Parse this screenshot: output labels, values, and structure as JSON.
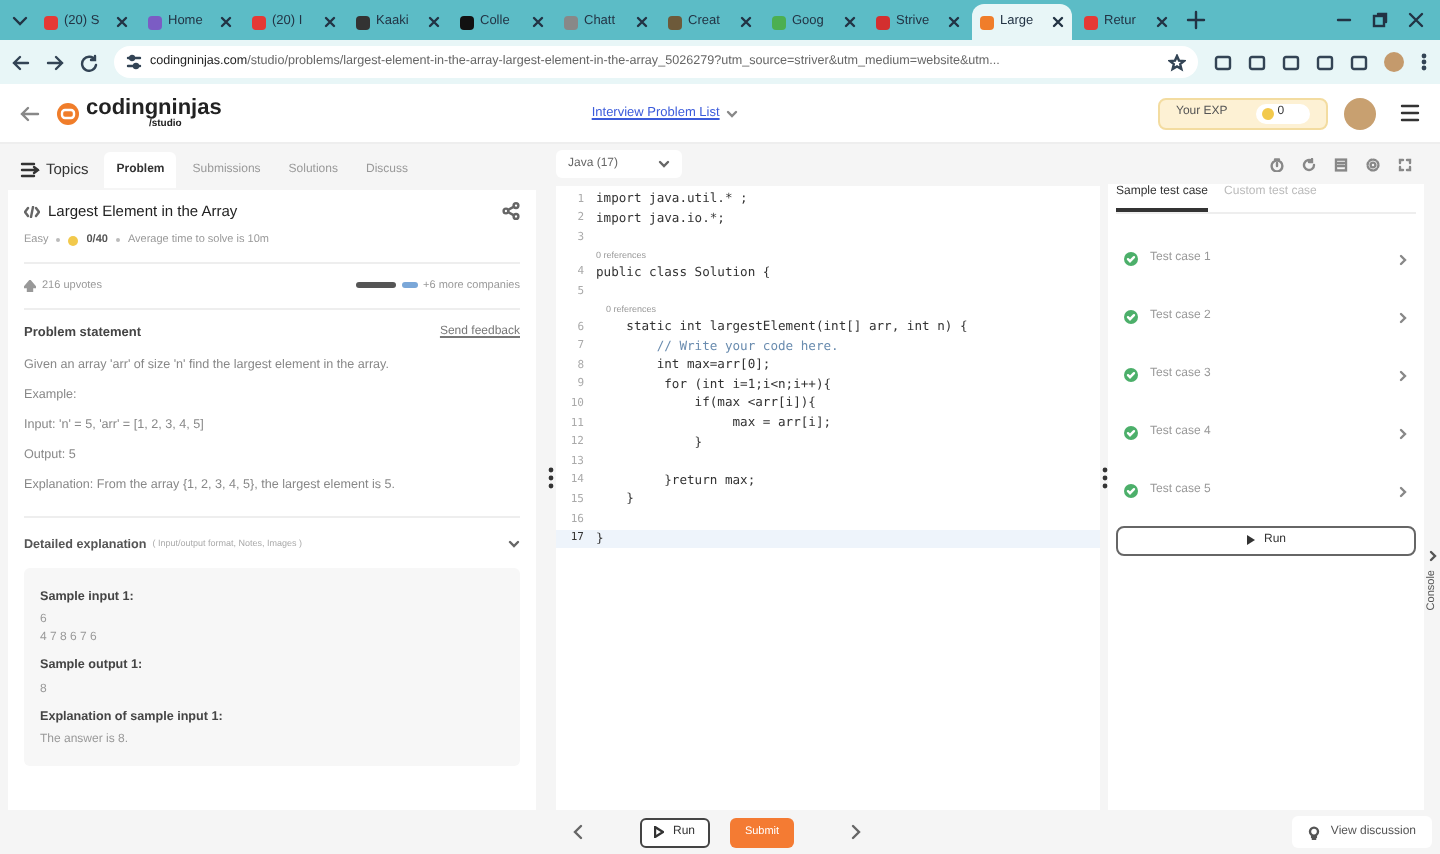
{
  "browser": {
    "tabs": [
      {
        "title": "(20) S",
        "selected": false,
        "color": "#e53935"
      },
      {
        "title": "Home",
        "selected": false,
        "color": "#7b5cc4"
      },
      {
        "title": "(20) I",
        "selected": false,
        "color": "#e53935"
      },
      {
        "title": "Kaaki",
        "selected": false,
        "color": "#333333"
      },
      {
        "title": "Colle",
        "selected": false,
        "color": "#111111"
      },
      {
        "title": "Chatt",
        "selected": false,
        "color": "#888888"
      },
      {
        "title": "Creat",
        "selected": false,
        "color": "#6d5a3a"
      },
      {
        "title": "Goog",
        "selected": false,
        "color": "#4caf50"
      },
      {
        "title": "Strive",
        "selected": false,
        "color": "#d32f2f"
      },
      {
        "title": "Large",
        "selected": true,
        "color": "#f07d2a"
      },
      {
        "title": "Retur",
        "selected": false,
        "color": "#e53935"
      }
    ],
    "url_host": "codingninjas.com",
    "url_path": "/studio/problems/largest-element-in-the-array-largest-element-in-the-array_5026279?utm_source=striver&utm_medium=website&utm..."
  },
  "header": {
    "logo": "codingninjas",
    "logo_sub": "/studio",
    "nav_link": "Interview Problem List",
    "exp_label": "Your EXP",
    "exp_value": "0"
  },
  "left": {
    "tabs": [
      {
        "label": "Topics",
        "selected": false
      },
      {
        "label": "Problem",
        "selected": true
      },
      {
        "label": "Submissions",
        "selected": false
      },
      {
        "label": "Solutions",
        "selected": false
      },
      {
        "label": "Discuss",
        "selected": false
      }
    ],
    "title": "Largest Element in the Array",
    "difficulty": "Easy",
    "score": "0/40",
    "avg_time": "Average time to solve is 10m",
    "upvotes": "216 upvotes",
    "companies": "+6 more companies",
    "statement_title": "Problem statement",
    "feedback": "Send feedback",
    "paragraphs": [
      "Given an array 'arr' of size 'n' find the largest element in the array.",
      "Example:",
      "Input: 'n' = 5, 'arr' = [1, 2, 3, 4, 5]",
      "Output: 5",
      "Explanation: From the array {1, 2, 3, 4, 5}, the largest element is 5."
    ],
    "detail_title": "Detailed explanation",
    "detail_hint": "( Input/output format, Notes, Images )",
    "expanded": true,
    "sample": [
      {
        "kind": "heading",
        "text": "Sample input 1:"
      },
      {
        "kind": "value",
        "text": "6"
      },
      {
        "kind": "value",
        "text": "4 7 8 6 7 6"
      },
      {
        "kind": "heading",
        "text": "Sample output 1:"
      },
      {
        "kind": "value",
        "text": "8"
      },
      {
        "kind": "heading",
        "text": "Explanation of sample input 1:"
      },
      {
        "kind": "value",
        "text": "The answer is 8."
      }
    ]
  },
  "editor": {
    "language": "Java (17)",
    "lines": [
      {
        "number": "1",
        "text": "import java.util.* ;",
        "kind": "code",
        "current": false
      },
      {
        "number": "2",
        "text": "import java.io.*;",
        "kind": "code",
        "current": false
      },
      {
        "number": "3",
        "current": false
      },
      {
        "number": "4",
        "text": "public class Solution {",
        "kind": "code",
        "codelens": "0 references",
        "current": false
      },
      {
        "number": "5",
        "current": false
      },
      {
        "number": "6",
        "text": "    static int largestElement(int[] arr, int n) {",
        "kind": "code",
        "codelens": "0 references",
        "current": false
      },
      {
        "number": "7",
        "text": "        // Write your code here.",
        "kind": "comment",
        "current": false
      },
      {
        "number": "8",
        "text": "        int max=arr[0];",
        "kind": "code",
        "current": false
      },
      {
        "number": "9",
        "text": "         for (int i=1;i<n;i++){",
        "kind": "code",
        "current": false
      },
      {
        "number": "10",
        "text": "             if(max <arr[i]){",
        "kind": "code",
        "current": false
      },
      {
        "number": "11",
        "text": "                  max = arr[i];",
        "kind": "code",
        "current": false
      },
      {
        "number": "12",
        "text": "             }",
        "kind": "code",
        "current": false
      },
      {
        "number": "13",
        "current": false
      },
      {
        "number": "14",
        "text": "         }return max;",
        "kind": "code",
        "current": false
      },
      {
        "number": "15",
        "text": "    }",
        "kind": "code",
        "current": false
      },
      {
        "number": "16",
        "current": false
      },
      {
        "number": "17",
        "text": "}",
        "kind": "code",
        "current": true
      }
    ]
  },
  "tests": {
    "tabs": [
      {
        "label": "Sample test case",
        "selected": true
      },
      {
        "label": "Custom test case",
        "selected": false
      }
    ],
    "cases": [
      {
        "label": "Test case 1",
        "passed": true
      },
      {
        "label": "Test case 2",
        "passed": true
      },
      {
        "label": "Test case 3",
        "passed": true
      },
      {
        "label": "Test case 4",
        "passed": true
      },
      {
        "label": "Test case 5",
        "passed": true
      }
    ],
    "run": "Run",
    "console": "Console"
  },
  "footer": {
    "run": "Run",
    "submit": "Submit",
    "discussion": "View discussion"
  }
}
